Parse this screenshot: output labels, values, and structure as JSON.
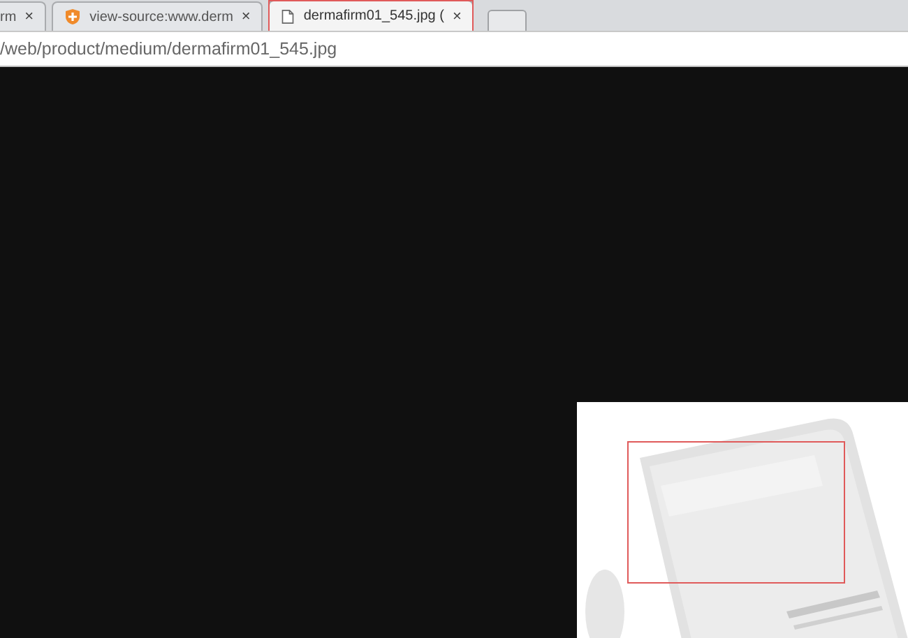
{
  "tabs": [
    {
      "label": "rm",
      "selected": false,
      "close": "×"
    },
    {
      "label": "view-source:www.derm",
      "selected": false,
      "close": "×"
    },
    {
      "label": "dermafirm01_545.jpg (",
      "selected": true,
      "close": "×"
    }
  ],
  "address": {
    "value": "/web/product/medium/dermafirm01_545.jpg"
  }
}
